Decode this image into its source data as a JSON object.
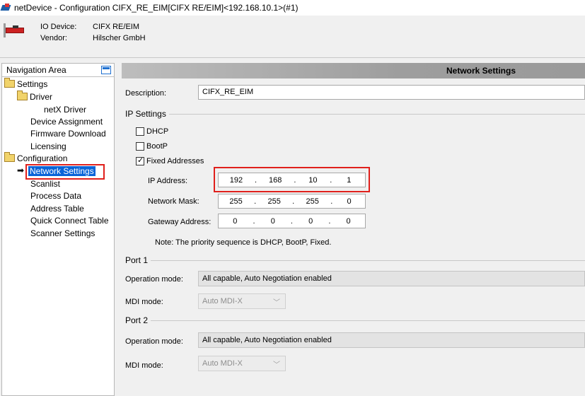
{
  "window": {
    "title": "netDevice - Configuration CIFX_RE_EIM[CIFX RE/EIM]<192.168.10.1>(#1)"
  },
  "header": {
    "io_device_label": "IO Device:",
    "io_device_value": "CIFX RE/EIM",
    "vendor_label": "Vendor:",
    "vendor_value": "Hilscher GmbH"
  },
  "nav": {
    "title": "Navigation Area",
    "items": [
      {
        "label": "Settings"
      },
      {
        "label": "Driver"
      },
      {
        "label": "netX Driver"
      },
      {
        "label": "Device Assignment"
      },
      {
        "label": "Firmware Download"
      },
      {
        "label": "Licensing"
      },
      {
        "label": "Configuration"
      },
      {
        "label": "Network Settings"
      },
      {
        "label": "Scanlist"
      },
      {
        "label": "Process Data"
      },
      {
        "label": "Address Table"
      },
      {
        "label": "Quick Connect Table"
      },
      {
        "label": "Scanner Settings"
      }
    ]
  },
  "panel": {
    "title": "Network Settings",
    "description_label": "Description:",
    "description_value": "CIFX_RE_EIM",
    "ip_settings": {
      "title": "IP Settings",
      "dhcp": {
        "label": "DHCP",
        "checked": false
      },
      "bootp": {
        "label": "BootP",
        "checked": false
      },
      "fixed": {
        "label": "Fixed Addresses",
        "checked": true
      },
      "ip_label": "IP Address:",
      "ip": [
        "192",
        "168",
        "10",
        "1"
      ],
      "mask_label": "Network Mask:",
      "mask": [
        "255",
        "255",
        "255",
        "0"
      ],
      "gateway_label": "Gateway Address:",
      "gateway": [
        "0",
        "0",
        "0",
        "0"
      ],
      "dot": ".",
      "note": "Note: The priority sequence is DHCP, BootP, Fixed."
    },
    "port1": {
      "title": "Port 1",
      "operation_label": "Operation mode:",
      "operation_value": "All capable, Auto Negotiation enabled",
      "mdi_label": "MDI mode:",
      "mdi_value": "Auto MDI-X"
    },
    "port2": {
      "title": "Port 2",
      "operation_label": "Operation mode:",
      "operation_value": "All capable, Auto Negotiation enabled",
      "mdi_label": "MDI mode:",
      "mdi_value": "Auto MDI-X"
    }
  },
  "colors": {
    "selection": "#0a64d8",
    "highlight_box": "#e0201c"
  }
}
